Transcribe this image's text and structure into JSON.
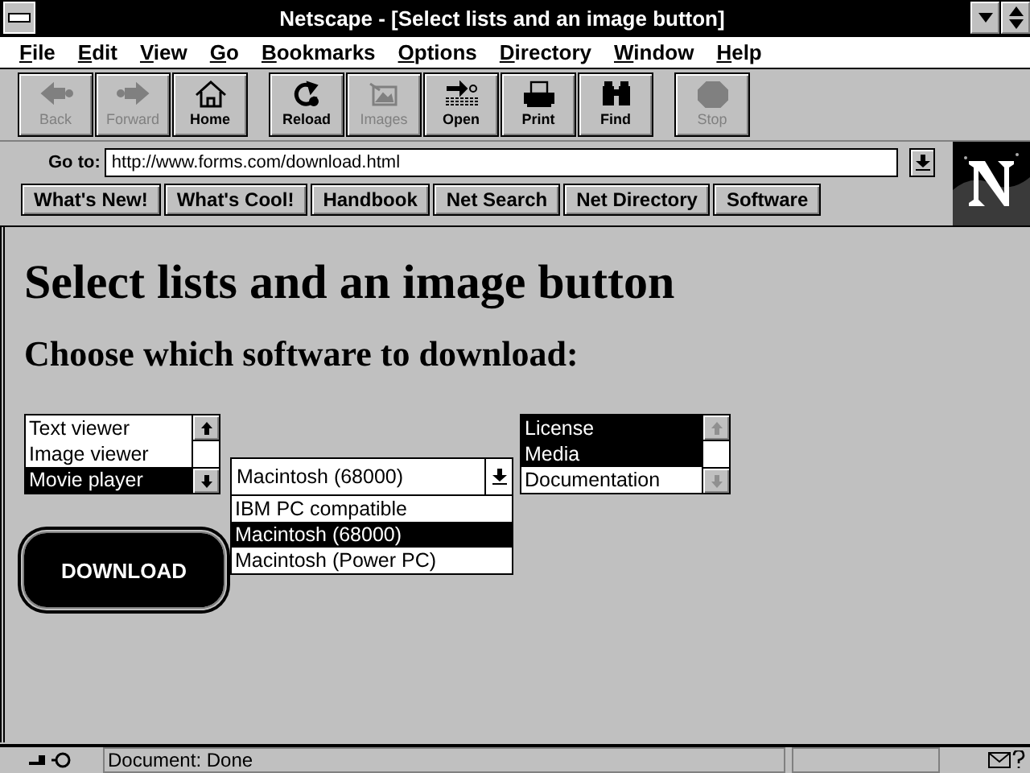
{
  "window": {
    "title": "Netscape - [Select lists and an image button]"
  },
  "menu": [
    {
      "label": "File"
    },
    {
      "label": "Edit"
    },
    {
      "label": "View"
    },
    {
      "label": "Go"
    },
    {
      "label": "Bookmarks"
    },
    {
      "label": "Options"
    },
    {
      "label": "Directory"
    },
    {
      "label": "Window"
    },
    {
      "label": "Help"
    }
  ],
  "toolbar": [
    {
      "label": "Back",
      "kind": "back",
      "disabled": true
    },
    {
      "label": "Forward",
      "kind": "forward",
      "disabled": true
    },
    {
      "label": "Home",
      "kind": "home",
      "disabled": false
    },
    {
      "label": "Reload",
      "kind": "reload",
      "disabled": false
    },
    {
      "label": "Images",
      "kind": "images",
      "disabled": true
    },
    {
      "label": "Open",
      "kind": "open",
      "disabled": false
    },
    {
      "label": "Print",
      "kind": "print",
      "disabled": false
    },
    {
      "label": "Find",
      "kind": "find",
      "disabled": false
    },
    {
      "label": "Stop",
      "kind": "stop",
      "disabled": true
    }
  ],
  "location": {
    "label": "Go to:",
    "value": "http://www.forms.com/download.html"
  },
  "directory_buttons": [
    "What's New!",
    "What's Cool!",
    "Handbook",
    "Net Search",
    "Net Directory",
    "Software"
  ],
  "page": {
    "heading": "Select lists and an image button",
    "subheading": "Choose which software to download:",
    "list_1": {
      "options": [
        {
          "label": "Text viewer",
          "selected": false
        },
        {
          "label": "Image viewer",
          "selected": false
        },
        {
          "label": "Movie player",
          "selected": true
        }
      ]
    },
    "select": {
      "value": "Macintosh (68000)",
      "expanded": true,
      "options": [
        {
          "label": "IBM PC compatible",
          "selected": false
        },
        {
          "label": "Macintosh (68000)",
          "selected": true
        },
        {
          "label": "Macintosh (Power PC)",
          "selected": false
        }
      ]
    },
    "list_2": {
      "options": [
        {
          "label": "License",
          "selected": true
        },
        {
          "label": "Media",
          "selected": true
        },
        {
          "label": "Documentation",
          "selected": false
        }
      ]
    },
    "image_button": {
      "label": "DOWNLOAD"
    }
  },
  "status_bar": {
    "text": "Document: Done"
  }
}
